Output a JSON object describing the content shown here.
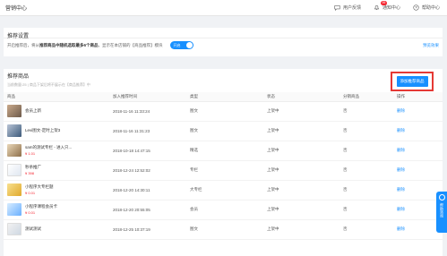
{
  "topbar": {
    "title": "营销中心",
    "feedback": "用户反馈",
    "notice": "通知中心",
    "notice_badge": "99",
    "help": "帮助中心"
  },
  "settings": {
    "title": "推荐设置",
    "desc_prefix": "开启推荐后，将从",
    "desc_bold": "推荐商品中随机选取最多6个商品",
    "desc_suffix": "，显示在本店铺的【商品推荐】模块",
    "toggle_label": "开启",
    "preview": "预览效果"
  },
  "goods": {
    "title": "推荐商品",
    "tip": "当前数量:25 | 商品下架后将不展示在【商品推荐】中",
    "add_button": "添加推荐商品",
    "columns": [
      "商品",
      "加入推荐时间",
      "类型",
      "状态",
      "分销商品",
      "操作"
    ],
    "rows": [
      {
        "name": "会员上新",
        "price": "",
        "time": "2018-11-16 11:33:24",
        "type": "图文",
        "status": "上架中",
        "dist": "否",
        "op": "删除"
      },
      {
        "name": "Levi图文-定时上架3",
        "price": "",
        "time": "2018-11-16 11:31:23",
        "type": "图文",
        "status": "上架中",
        "dist": "否",
        "op": "删除"
      },
      {
        "name": "sam的测试专栏 - 进入只...",
        "price": "¥ 1.01",
        "time": "2018-10-18 14:47:15",
        "type": "精选",
        "status": "上架中",
        "dist": "否",
        "op": "删除"
      },
      {
        "name": "秒杀推广",
        "price": "¥ 398",
        "time": "2018-12-24 12:52:02",
        "type": "专栏",
        "status": "上架中",
        "dist": "否",
        "op": "删除"
      },
      {
        "name": "小程序大专栏题",
        "price": "¥ 0.01",
        "time": "2018-12-20 14:30:11",
        "type": "大专栏",
        "status": "上架中",
        "dist": "否",
        "op": "删除"
      },
      {
        "name": "小程序课程会员卡",
        "price": "¥ 0.01",
        "time": "2018-12-20 20:55:05",
        "type": "会员",
        "status": "上架中",
        "dist": "否",
        "op": "删除"
      },
      {
        "name": "测试测试",
        "price": "",
        "time": "2018-12-25 10:37:19",
        "type": "图文",
        "status": "上架中",
        "dist": "否",
        "op": "删除"
      }
    ]
  },
  "float_tab": {
    "label": "帮助咨询"
  }
}
